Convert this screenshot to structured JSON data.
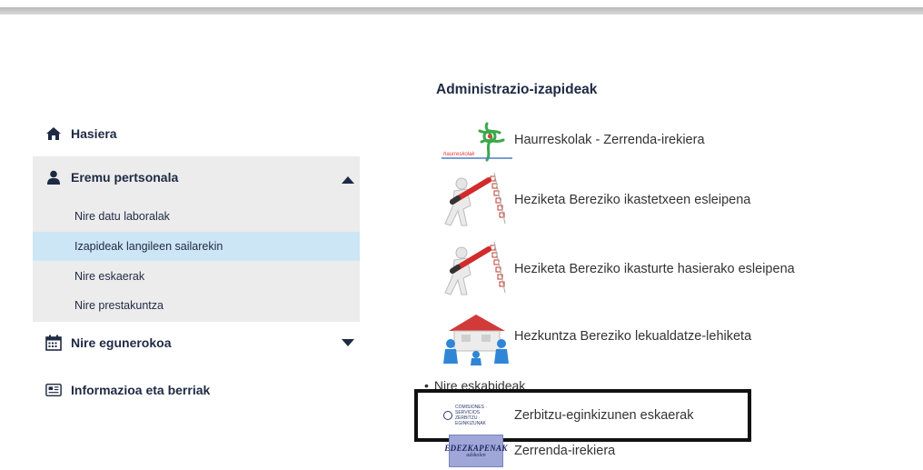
{
  "sidebar": {
    "items": [
      {
        "label": "Hasiera",
        "icon": "home-icon"
      },
      {
        "label": "Eremu pertsonala",
        "icon": "user-icon",
        "expanded": true
      },
      {
        "label": "Nire egunerokoa",
        "icon": "calendar-icon",
        "expanded": false
      },
      {
        "label": "Informazioa eta berriak",
        "icon": "newspaper-icon"
      }
    ],
    "subitems": [
      {
        "label": "Nire datu laboralak"
      },
      {
        "label": "Izapideak langileen sailarekin",
        "active": true
      },
      {
        "label": "Nire eskaerak"
      },
      {
        "label": "Nire prestakuntza"
      }
    ]
  },
  "main": {
    "title": "Administrazio-izapideak",
    "apps": [
      {
        "label": "Haurreskolak - Zerrenda-irekiera",
        "icon": "haurreskolak-logo-icon"
      },
      {
        "label": "Heziketa Bereziko ikastetxeen esleipena",
        "icon": "figure-with-pencil-icon"
      },
      {
        "label": "Heziketa Bereziko ikasturte hasierako esleipena",
        "icon": "figure-with-pencil-icon"
      },
      {
        "label": "Hezkuntza Bereziko lekualdatze-lehiketa",
        "icon": "figures-carrying-house-icon"
      }
    ],
    "section_label": "Nire eskabideak",
    "requests": [
      {
        "label": "Zerbitzu-eginkizunen eskaerak",
        "icon": "zerbitzu-logo-icon"
      },
      {
        "label": "Zerrenda-irekiera",
        "icon": "edezkapenak-logo-icon"
      }
    ],
    "zerbitzu_logo": {
      "line1": "COMISIONES · SERVICIOS",
      "line2": "ZERBITZU · EGINKIZUNAK"
    },
    "ed_logo": {
      "line1": "EDEZKAPENAK",
      "line2": "adskolen"
    }
  },
  "colors": {
    "active_sub": "#cde6f5",
    "menu_bg": "#ececec",
    "text": "#1f2a44"
  }
}
